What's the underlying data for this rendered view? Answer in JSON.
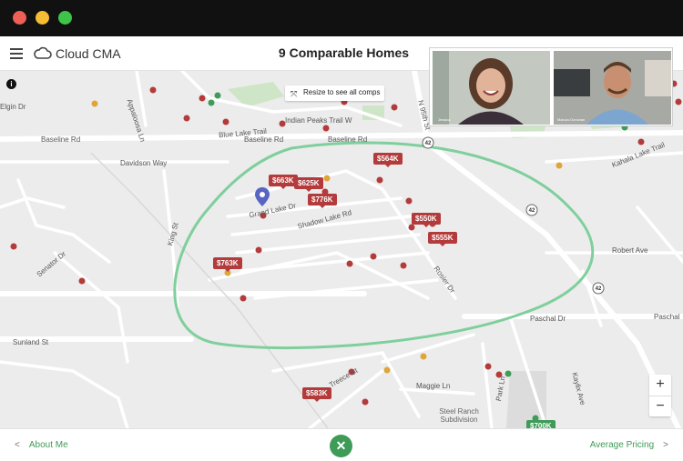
{
  "window": {
    "controls": [
      "close",
      "minimize",
      "maximize"
    ]
  },
  "appbar": {
    "brand": "Cloud CMA",
    "title": "9 Comparable Homes",
    "menu_icon": "hamburger-icon",
    "logo_icon": "cloud-icon"
  },
  "map": {
    "resize_label": "Resize to see all comps",
    "zoom_in": "+",
    "zoom_out": "−",
    "info": "i",
    "streets": [
      "Baseline Rd",
      "Baseline Rd",
      "Baseline Rd",
      "Davidson Way",
      "Blue Lake Trail",
      "Indian Peaks Trail W",
      "Grand Lake Dr",
      "Shadow Lake Rd",
      "King St",
      "Robert Ave",
      "Paschal Dr",
      "Paschal",
      "Sunland St",
      "Senator Dr",
      "Treece St",
      "Maggie Ln",
      "Steel Ranch Subdivision",
      "Park Ln",
      "Kaylix Ave",
      "Rosier Dr",
      "N 95th St",
      "Kahala Lake Trail",
      "Appaloosa Ln",
      "Elgin Dr"
    ],
    "prices": [
      {
        "label": "$663K",
        "color": "red"
      },
      {
        "label": "$625K",
        "color": "red"
      },
      {
        "label": "$776K",
        "color": "red"
      },
      {
        "label": "$564K",
        "color": "red"
      },
      {
        "label": "$550K",
        "color": "red"
      },
      {
        "label": "$555K",
        "color": "red"
      },
      {
        "label": "$763K",
        "color": "red"
      },
      {
        "label": "$583K",
        "color": "red"
      },
      {
        "label": "$700K",
        "color": "green"
      }
    ],
    "highway_shields": [
      "42",
      "42",
      "42"
    ],
    "colors": {
      "comp": "#b33b3b",
      "active": "#3f9b58",
      "pending": "#e0a53a",
      "subject_pin": "#5865c3",
      "boundary": "#7fcf9c"
    }
  },
  "video": {
    "caption_left": "Jessica",
    "caption_right": "Marcus Donovan"
  },
  "footer": {
    "prev_label": "About Me",
    "next_label": "Average Pricing",
    "close_icon": "close-icon",
    "accent": "#3f9b58"
  }
}
